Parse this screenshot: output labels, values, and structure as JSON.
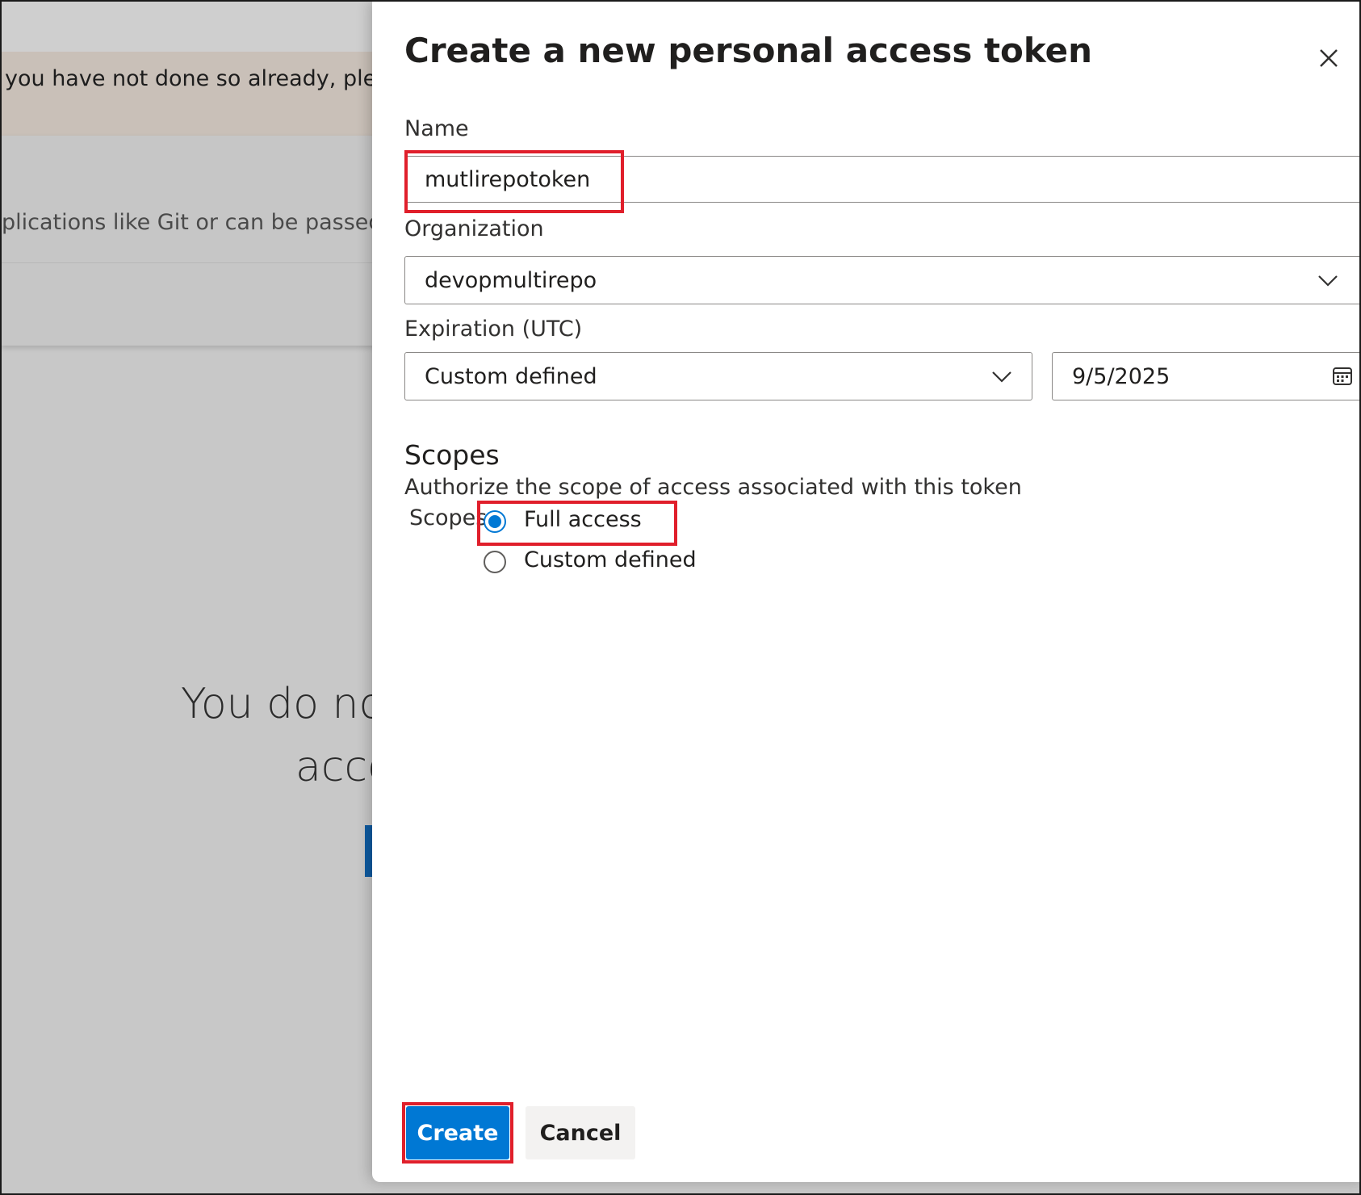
{
  "background": {
    "notice_text": "you have not done so already, please",
    "description_text": "plications like Git or can be passed in",
    "empty_state_line1": "You do no",
    "empty_state_line2": "acce"
  },
  "dialog": {
    "title": "Create a new personal access token",
    "name": {
      "label": "Name",
      "value": "mutlirepotoken"
    },
    "organization": {
      "label": "Organization",
      "selected": "devopmultirepo"
    },
    "expiration": {
      "label": "Expiration (UTC)",
      "selected": "Custom defined",
      "date": "9/5/2025"
    },
    "scopes": {
      "title": "Scopes",
      "subtitle": "Authorize the scope of access associated with this token",
      "field_label": "Scopes",
      "options": [
        {
          "label": "Full access",
          "selected": true
        },
        {
          "label": "Custom defined",
          "selected": false
        }
      ]
    },
    "buttons": {
      "create": "Create",
      "cancel": "Cancel"
    }
  },
  "colors": {
    "accent": "#0078d4",
    "highlight": "#e01f2b"
  },
  "icons": [
    "close-icon",
    "chevron-down-icon",
    "calendar-icon",
    "radio-selected-icon",
    "radio-unselected-icon"
  ]
}
